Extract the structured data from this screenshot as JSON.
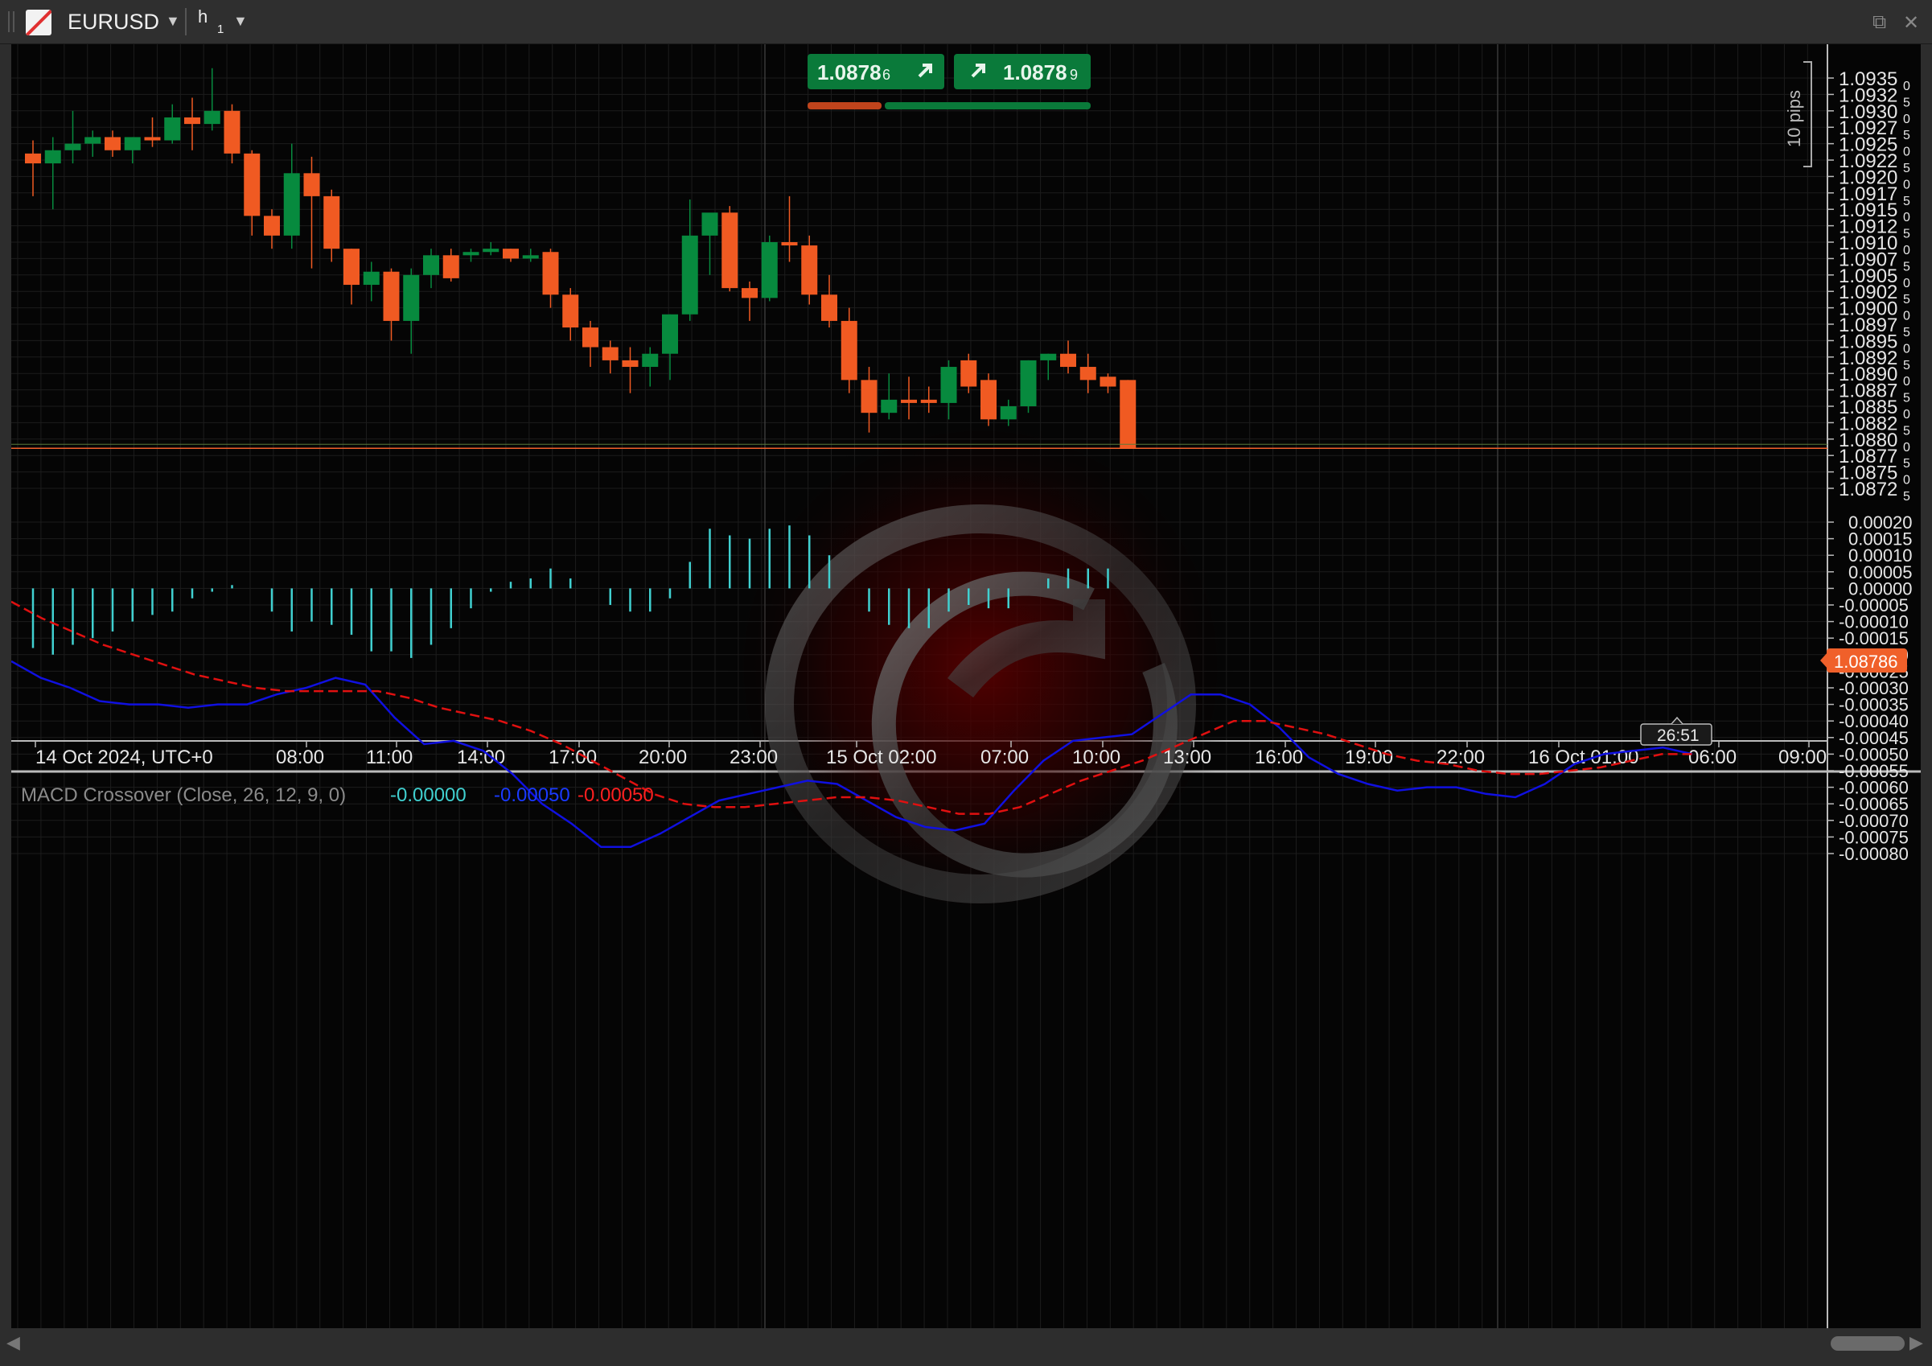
{
  "titlebar": {
    "symbol": "EURUSD",
    "timeframe": "h",
    "timeframe_sub": "1",
    "dropdown_glyph": "▼",
    "popout_glyph": "⧉",
    "close_glyph": "✕"
  },
  "quote": {
    "bid": "1.0878",
    "bid_sub": "6",
    "ask": "1.0878",
    "ask_sub": "9",
    "sell_color": "#c0441c",
    "buy_color": "#0a7a3a"
  },
  "price_panel": {
    "pips_label": "10 pips",
    "current_price": "1.08786",
    "current_price_color": "#f0602a",
    "countdown": "26:51",
    "y_ticks": [
      {
        "main": "1.0935",
        "sub": "0"
      },
      {
        "main": "1.0932",
        "sub": "5"
      },
      {
        "main": "1.0930",
        "sub": "0"
      },
      {
        "main": "1.0927",
        "sub": "5"
      },
      {
        "main": "1.0925",
        "sub": "0"
      },
      {
        "main": "1.0922",
        "sub": "5"
      },
      {
        "main": "1.0920",
        "sub": "0"
      },
      {
        "main": "1.0917",
        "sub": "5"
      },
      {
        "main": "1.0915",
        "sub": "0"
      },
      {
        "main": "1.0912",
        "sub": "5"
      },
      {
        "main": "1.0910",
        "sub": "0"
      },
      {
        "main": "1.0907",
        "sub": "5"
      },
      {
        "main": "1.0905",
        "sub": "0"
      },
      {
        "main": "1.0902",
        "sub": "5"
      },
      {
        "main": "1.0900",
        "sub": "0"
      },
      {
        "main": "1.0897",
        "sub": "5"
      },
      {
        "main": "1.0895",
        "sub": "0"
      },
      {
        "main": "1.0892",
        "sub": "5"
      },
      {
        "main": "1.0890",
        "sub": "0"
      },
      {
        "main": "1.0887",
        "sub": "5"
      },
      {
        "main": "1.0885",
        "sub": "0"
      },
      {
        "main": "1.0882",
        "sub": "5"
      },
      {
        "main": "1.0880",
        "sub": "0"
      },
      {
        "main": "1.0877",
        "sub": "5"
      },
      {
        "main": "1.0875",
        "sub": "0"
      },
      {
        "main": "1.0872",
        "sub": "5"
      }
    ],
    "x_ticks": [
      "14 Oct 2024, UTC+0",
      "08:00",
      "11:00",
      "14:00",
      "17:00",
      "20:00",
      "23:00",
      "15 Oct 02:00",
      "07:00",
      "10:00",
      "13:00",
      "16:00",
      "19:00",
      "22:00",
      "16 Oct 01:00",
      "06:00",
      "09:00"
    ]
  },
  "indicator": {
    "name": "MACD Crossover (Close, 26, 12, 9, 0)",
    "hist_value": "-0.00000",
    "macd_value": "-0.00050",
    "signal_value": "-0.00050",
    "hist_color": "#40d0d0",
    "macd_color": "#1010e0",
    "signal_color": "#e01010",
    "y_ticks": [
      "0.00020",
      "0.00015",
      "0.00010",
      "0.00005",
      "0.00000",
      "-0.00005",
      "-0.00010",
      "-0.00015",
      "-0.00020",
      "-0.00025",
      "-0.00030",
      "-0.00035",
      "-0.00040",
      "-0.00045",
      "-0.00050",
      "-0.00055",
      "-0.00060",
      "-0.00065",
      "-0.00070",
      "-0.00075",
      "-0.00080"
    ]
  },
  "chart_data": [
    {
      "type": "candlestick",
      "title": "EURUSD h1",
      "up_color": "#078a3e",
      "down_color": "#f05a22",
      "ylim": [
        1.08715,
        1.09365
      ],
      "candles": [
        [
          1.09235,
          1.09255,
          1.0917,
          1.0922
        ],
        [
          1.0922,
          1.0926,
          1.0915,
          1.0924
        ],
        [
          1.0924,
          1.093,
          1.0922,
          1.0925
        ],
        [
          1.0925,
          1.0927,
          1.0923,
          1.0926
        ],
        [
          1.0926,
          1.0927,
          1.0923,
          1.0924
        ],
        [
          1.0924,
          1.0926,
          1.0922,
          1.0926
        ],
        [
          1.0926,
          1.0929,
          1.09245,
          1.09255
        ],
        [
          1.09255,
          1.0931,
          1.0925,
          1.0929
        ],
        [
          1.0929,
          1.0932,
          1.0924,
          1.0928
        ],
        [
          1.0928,
          1.09365,
          1.0927,
          1.093
        ],
        [
          1.093,
          1.0931,
          1.0922,
          1.09235
        ],
        [
          1.09235,
          1.0924,
          1.0911,
          1.0914
        ],
        [
          1.0914,
          1.0915,
          1.0909,
          1.0911
        ],
        [
          1.0911,
          1.0925,
          1.0909,
          1.09205
        ],
        [
          1.09205,
          1.0923,
          1.0906,
          1.0917
        ],
        [
          1.0917,
          1.0918,
          1.0907,
          1.0909
        ],
        [
          1.0909,
          1.0909,
          1.09005,
          1.09035
        ],
        [
          1.09035,
          1.0907,
          1.0901,
          1.09055
        ],
        [
          1.09055,
          1.0906,
          1.0895,
          1.0898
        ],
        [
          1.0898,
          1.0906,
          1.0893,
          1.0905
        ],
        [
          1.0905,
          1.0909,
          1.0903,
          1.0908
        ],
        [
          1.0908,
          1.0909,
          1.0904,
          1.09045
        ],
        [
          1.0908,
          1.0909,
          1.0907,
          1.09085
        ],
        [
          1.09085,
          1.091,
          1.0908,
          1.0909
        ],
        [
          1.0909,
          1.0909,
          1.0907,
          1.09075
        ],
        [
          1.09075,
          1.0909,
          1.0907,
          1.0908
        ],
        [
          1.09085,
          1.0909,
          1.09,
          1.0902
        ],
        [
          1.0902,
          1.0903,
          1.0895,
          1.0897
        ],
        [
          1.0897,
          1.0898,
          1.0891,
          1.0894
        ],
        [
          1.0894,
          1.0895,
          1.089,
          1.0892
        ],
        [
          1.0892,
          1.0894,
          1.0887,
          1.0891
        ],
        [
          1.0891,
          1.0894,
          1.0888,
          1.0893
        ],
        [
          1.0893,
          1.0899,
          1.0889,
          1.0899
        ],
        [
          1.0899,
          1.09165,
          1.0898,
          1.0911
        ],
        [
          1.0911,
          1.0914,
          1.0905,
          1.09145
        ],
        [
          1.09145,
          1.09155,
          1.09025,
          1.0903
        ],
        [
          1.0903,
          1.0904,
          1.0898,
          1.09015
        ],
        [
          1.09015,
          1.0911,
          1.0901,
          1.091
        ],
        [
          1.091,
          1.0917,
          1.0907,
          1.09095
        ],
        [
          1.09095,
          1.0911,
          1.09005,
          1.0902
        ],
        [
          1.0902,
          1.0905,
          1.0897,
          1.0898
        ],
        [
          1.0898,
          1.09,
          1.0887,
          1.0889
        ],
        [
          1.0889,
          1.0891,
          1.0881,
          1.0884
        ],
        [
          1.0884,
          1.089,
          1.0883,
          1.0886
        ],
        [
          1.0886,
          1.08895,
          1.0883,
          1.08855
        ],
        [
          1.0886,
          1.0888,
          1.0884,
          1.08855
        ],
        [
          1.08855,
          1.0892,
          1.0883,
          1.0891
        ],
        [
          1.0892,
          1.0893,
          1.0887,
          1.0888
        ],
        [
          1.0889,
          1.089,
          1.0882,
          1.0883
        ],
        [
          1.0883,
          1.0886,
          1.0882,
          1.0885
        ],
        [
          1.0885,
          1.0892,
          1.0884,
          1.0892
        ],
        [
          1.0892,
          1.0893,
          1.0889,
          1.0893
        ],
        [
          1.0893,
          1.0895,
          1.089,
          1.0891
        ],
        [
          1.0891,
          1.0893,
          1.0887,
          1.0889
        ],
        [
          1.08895,
          1.089,
          1.0887,
          1.0888
        ],
        [
          1.0889,
          1.0889,
          1.08786,
          1.08786
        ]
      ]
    },
    {
      "type": "line",
      "title": "MACD Crossover (Close, 26, 12, 9, 0)",
      "ylim": [
        -0.000825,
        0.000225
      ],
      "series": [
        {
          "name": "Histogram",
          "type": "bar",
          "values": [
            -0.00018,
            -0.0002,
            -0.00017,
            -0.00015,
            -0.00013,
            -0.0001,
            -8e-05,
            -7e-05,
            -3e-05,
            -1e-05,
            1e-05,
            0.0,
            -7e-05,
            -0.00013,
            -0.0001,
            -0.00011,
            -0.00014,
            -0.00019,
            -0.00019,
            -0.00021,
            -0.00017,
            -0.00012,
            -6e-05,
            -1e-05,
            2e-05,
            3e-05,
            6e-05,
            3e-05,
            0.0,
            -5e-05,
            -7e-05,
            -7e-05,
            -3e-05,
            8e-05,
            0.00018,
            0.00016,
            0.00015,
            0.00018,
            0.00019,
            0.00016,
            0.0001,
            0.0,
            -7e-05,
            -0.00011,
            -0.00012,
            -0.00012,
            -7e-05,
            -5e-05,
            -6e-05,
            -6e-05,
            0.0,
            3e-05,
            6e-05,
            6e-05,
            6e-05,
            0.0
          ]
        },
        {
          "name": "MACD",
          "values": [
            -0.00022,
            -0.00027,
            -0.0003,
            -0.00034,
            -0.00035,
            -0.00035,
            -0.00036,
            -0.00035,
            -0.00035,
            -0.00032,
            -0.0003,
            -0.00027,
            -0.00029,
            -0.00039,
            -0.00047,
            -0.00046,
            -0.00049,
            -0.00056,
            -0.00065,
            -0.00071,
            -0.00078,
            -0.00078,
            -0.00074,
            -0.00069,
            -0.00064,
            -0.00062,
            -0.0006,
            -0.00058,
            -0.00059,
            -0.00064,
            -0.00069,
            -0.00072,
            -0.00073,
            -0.00071,
            -0.00061,
            -0.00052,
            -0.00046,
            -0.00045,
            -0.00044,
            -0.00038,
            -0.00032,
            -0.00032,
            -0.00035,
            -0.00042,
            -0.00051,
            -0.00056,
            -0.00059,
            -0.00061,
            -0.0006,
            -0.0006,
            -0.00062,
            -0.00063,
            -0.00059,
            -0.00053,
            -0.0005,
            -0.00049,
            -0.00048,
            -0.0005
          ]
        },
        {
          "name": "Signal",
          "dashed": true,
          "values": [
            -4e-05,
            -9e-05,
            -0.00013,
            -0.00017,
            -0.0002,
            -0.00023,
            -0.00026,
            -0.00028,
            -0.0003,
            -0.00031,
            -0.00031,
            -0.00031,
            -0.00031,
            -0.00033,
            -0.00036,
            -0.00038,
            -0.0004,
            -0.00043,
            -0.00047,
            -0.00052,
            -0.00057,
            -0.00062,
            -0.00065,
            -0.00066,
            -0.00066,
            -0.00065,
            -0.00064,
            -0.00063,
            -0.00063,
            -0.00064,
            -0.00066,
            -0.00068,
            -0.00068,
            -0.00066,
            -0.00062,
            -0.00058,
            -0.00055,
            -0.00052,
            -0.00048,
            -0.00044,
            -0.0004,
            -0.0004,
            -0.00042,
            -0.00044,
            -0.00047,
            -0.0005,
            -0.00052,
            -0.00053,
            -0.00055,
            -0.00056,
            -0.00056,
            -0.00055,
            -0.00054,
            -0.00052,
            -0.0005,
            -0.0005
          ]
        }
      ]
    }
  ]
}
